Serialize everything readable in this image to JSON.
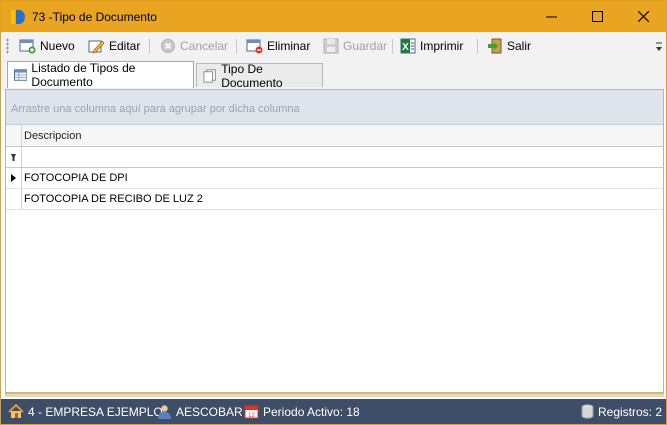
{
  "window": {
    "title": "73 -Tipo de Documento",
    "accent_color": "#e9a422",
    "controls": {
      "minimize_icon": "minimize-icon",
      "maximize_icon": "maximize-icon",
      "close_icon": "close-icon"
    }
  },
  "toolbar": {
    "new_label": "Nuevo",
    "edit_label": "Editar",
    "cancel_label": "Cancelar",
    "delete_label": "Eliminar",
    "save_label": "Guardar",
    "print_label": "Imprimir",
    "exit_label": "Salir",
    "disabled": [
      "Cancelar",
      "Guardar"
    ]
  },
  "tabs": [
    {
      "label": "Listado de Tipos de Documento",
      "active": true,
      "icon": "grid-list-icon"
    },
    {
      "label": "Tipo De Documento",
      "active": false,
      "icon": "document-pages-icon"
    }
  ],
  "grid": {
    "group_panel_text": "Arrastre una columna aquí para agrupar por dicha columna",
    "columns": [
      "Descripcion"
    ],
    "filter_value": "",
    "rows": [
      {
        "descripcion": "FOTOCOPIA DE DPI",
        "current": true
      },
      {
        "descripcion": "FOTOCOPIA DE RECIBO DE LUZ 2",
        "current": false
      }
    ]
  },
  "statusbar": {
    "company": "4 - EMPRESA EJEMPLO",
    "user": "AESCOBAR",
    "period": "Periodo Activo: 18",
    "records": "Registros: 2",
    "background_color": "#3e4e69"
  }
}
